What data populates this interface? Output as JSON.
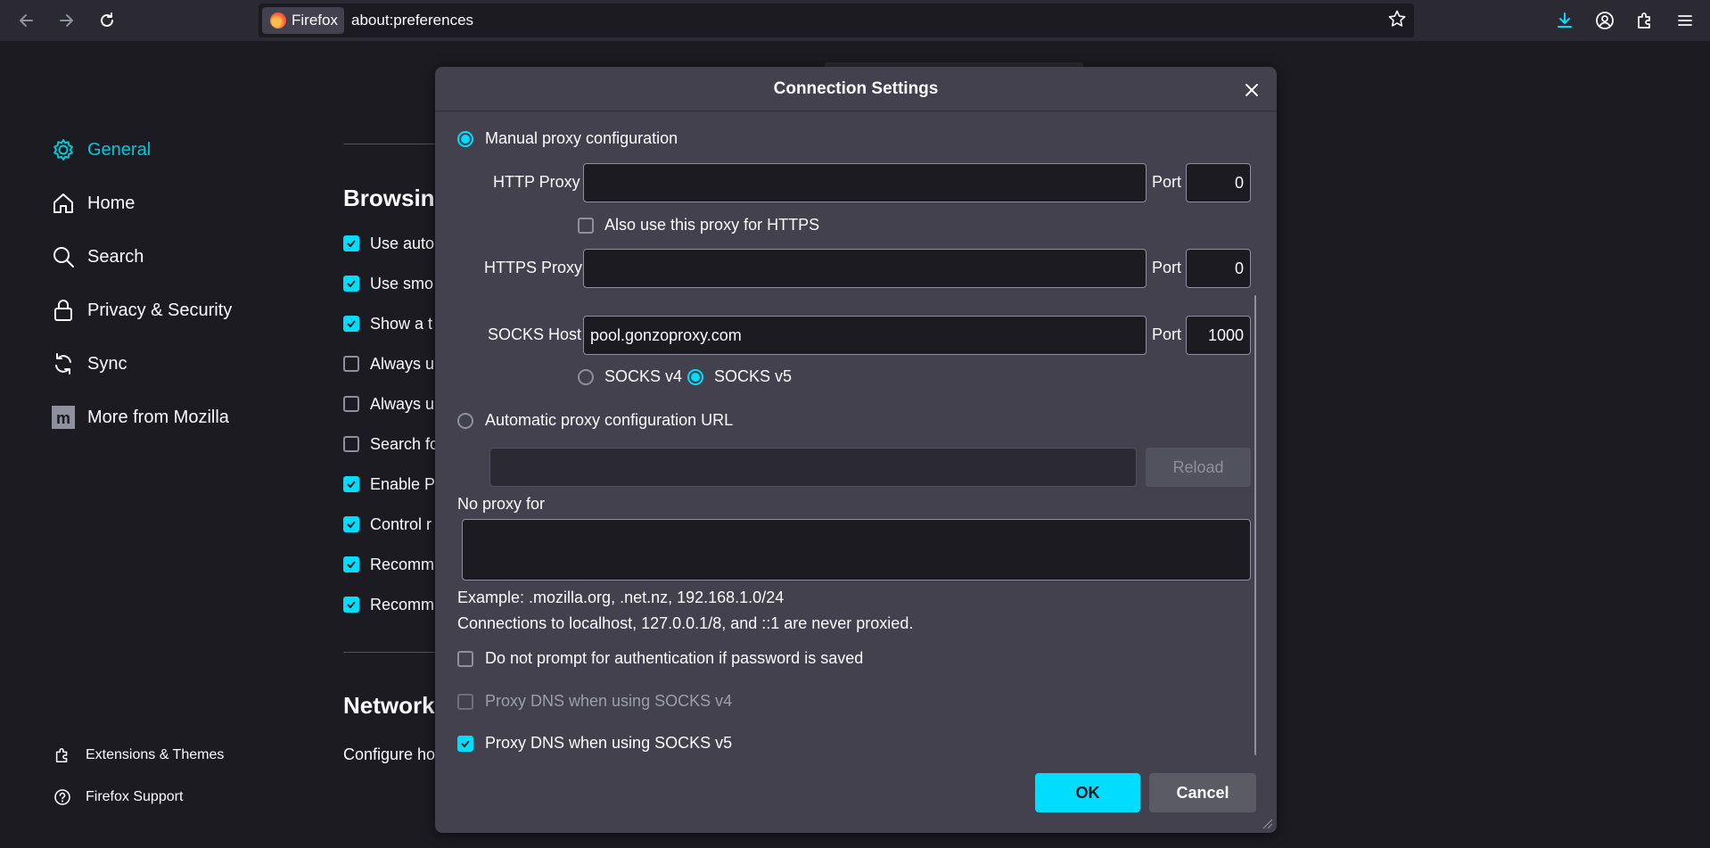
{
  "toolbar": {
    "identity_label": "Firefox",
    "url": "about:preferences"
  },
  "sidebar": {
    "items": [
      {
        "label": "General",
        "icon": "gear-icon",
        "active": true
      },
      {
        "label": "Home",
        "icon": "home-icon"
      },
      {
        "label": "Search",
        "icon": "search-icon"
      },
      {
        "label": "Privacy & Security",
        "icon": "lock-icon"
      },
      {
        "label": "Sync",
        "icon": "sync-icon"
      },
      {
        "label": "More from Mozilla",
        "icon": "mozilla-icon"
      }
    ],
    "footer": [
      {
        "label": "Extensions & Themes",
        "icon": "puzzle-icon"
      },
      {
        "label": "Firefox Support",
        "icon": "help-icon"
      }
    ]
  },
  "background": {
    "browsing_heading": "Browsing",
    "network_heading": "Network",
    "network_text": "Configure ho",
    "rows": [
      {
        "label": "Use auto",
        "checked": true
      },
      {
        "label": "Use smo",
        "checked": true
      },
      {
        "label": "Show a t",
        "checked": true
      },
      {
        "label": "Always u",
        "checked": false
      },
      {
        "label": "Always u",
        "checked": false
      },
      {
        "label": "Search fo",
        "checked": false
      },
      {
        "label": "Enable Pi",
        "checked": true
      },
      {
        "label": "Control r",
        "checked": true
      },
      {
        "label": "Recomm",
        "checked": true
      },
      {
        "label": "Recomm",
        "checked": true
      }
    ]
  },
  "dialog": {
    "title": "Connection Settings",
    "manual_label": "Manual proxy configuration",
    "http_proxy_label": "HTTP Proxy",
    "http_proxy_value": "",
    "port_label": "Port",
    "http_port_value": "0",
    "also_https_label": "Also use this proxy for HTTPS",
    "https_proxy_label": "HTTPS Proxy",
    "https_proxy_value": "",
    "https_port_value": "0",
    "socks_host_label": "SOCKS Host",
    "socks_host_value": "pool.gonzoproxy.com",
    "socks_port_value": "1000",
    "socks_v4_label": "SOCKS v4",
    "socks_v5_label": "SOCKS v5",
    "auto_url_label": "Automatic proxy configuration URL",
    "auto_url_value": "",
    "reload_label": "Reload",
    "no_proxy_label": "No proxy for",
    "no_proxy_value": "",
    "example_text": "Example: .mozilla.org, .net.nz, 192.168.1.0/24",
    "localhost_text": "Connections to localhost, 127.0.0.1/8, and ::1 are never proxied.",
    "no_prompt_label": "Do not prompt for authentication if password is saved",
    "dns_v4_label": "Proxy DNS when using SOCKS v4",
    "dns_v5_label": "Proxy DNS when using SOCKS v5",
    "ok_label": "OK",
    "cancel_label": "Cancel",
    "state": {
      "proxy_mode": "manual",
      "socks_version": "v5",
      "also_https": false,
      "no_prompt": false,
      "dns_v4": false,
      "dns_v5": true
    }
  },
  "colors": {
    "accent": "#00ddff",
    "active_nav": "#00c8d7",
    "dialog_bg": "#42414d",
    "page_bg": "#1c1b22"
  }
}
